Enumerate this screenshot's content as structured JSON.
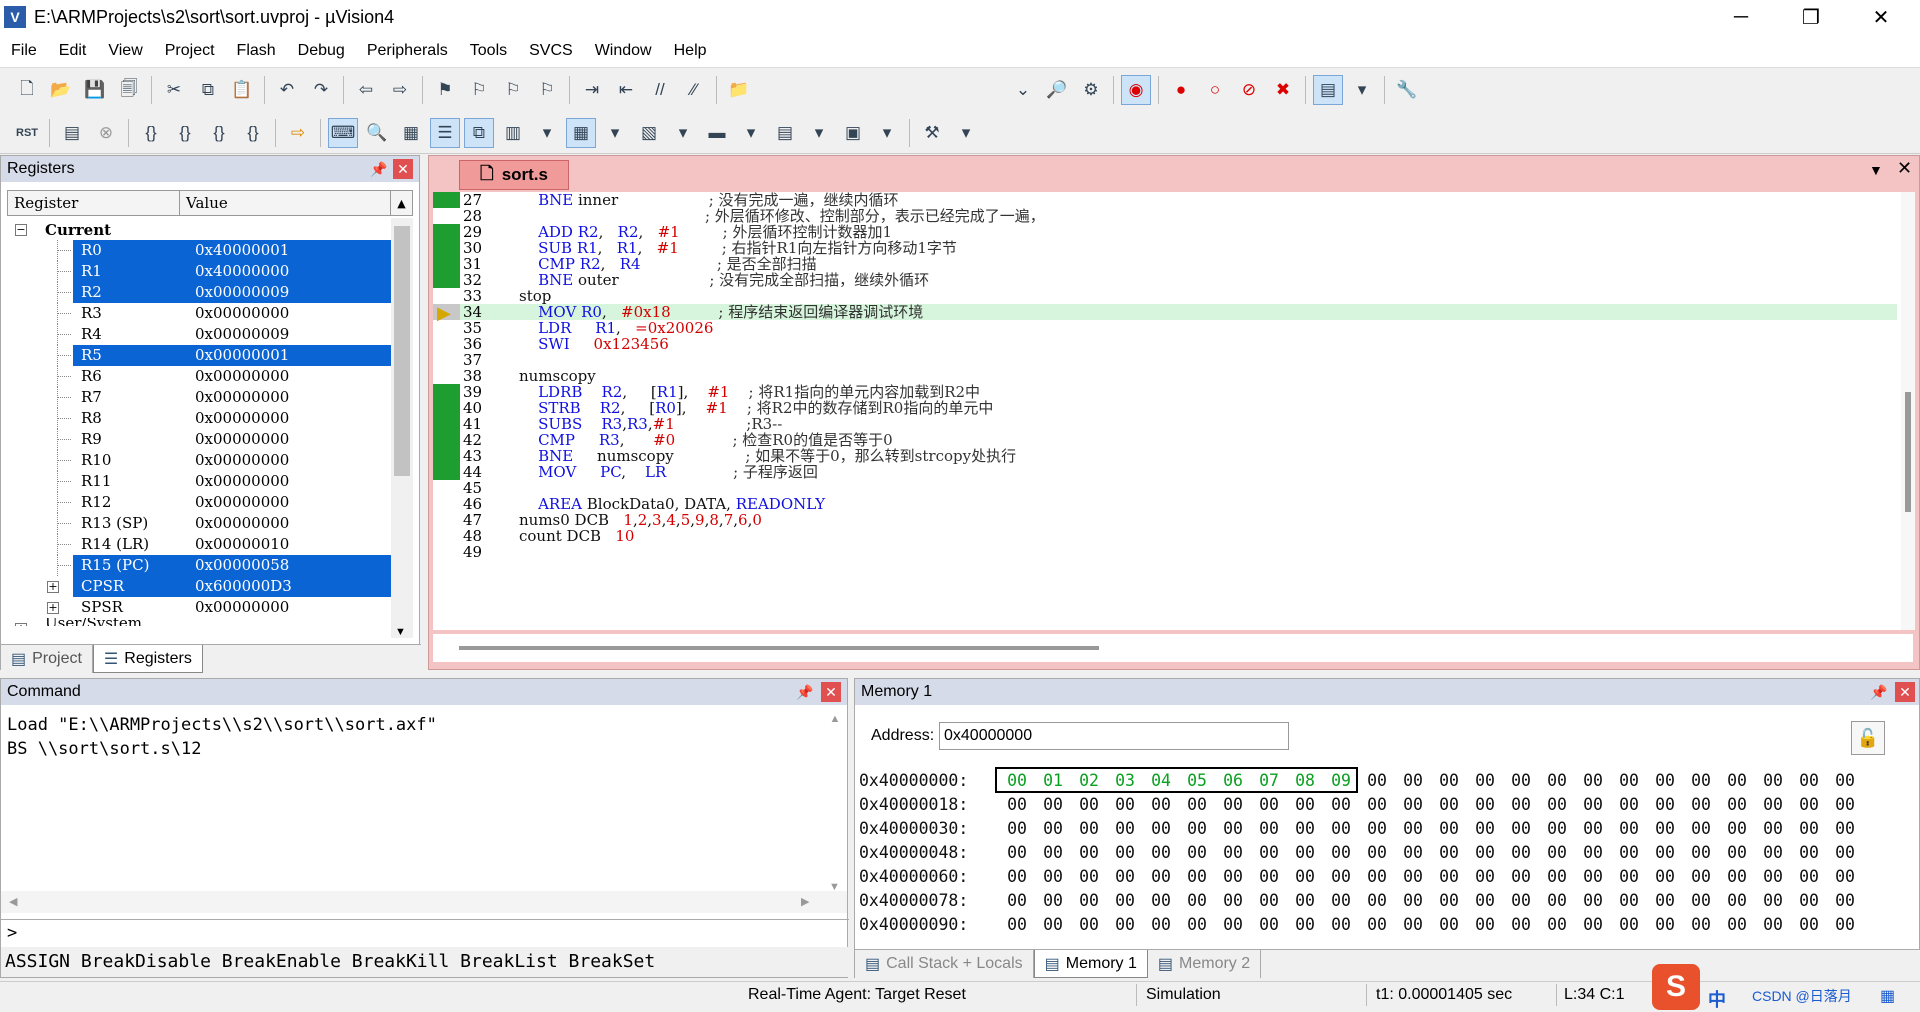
{
  "window": {
    "title": "E:\\ARMProjects\\s2\\sort\\sort.uvproj - µVision4",
    "icon": "v-logo-icon",
    "minimize": "─",
    "maximize": "❐",
    "close": "✕"
  },
  "menu": [
    "File",
    "Edit",
    "View",
    "Project",
    "Flash",
    "Debug",
    "Peripherals",
    "Tools",
    "SVCS",
    "Window",
    "Help"
  ],
  "registers": {
    "title": "Registers",
    "col_register": "Register",
    "col_value": "Value",
    "group": "Current",
    "rows": [
      {
        "name": "R0",
        "value": "0x40000001",
        "selected": true
      },
      {
        "name": "R1",
        "value": "0x40000000",
        "selected": true
      },
      {
        "name": "R2",
        "value": "0x00000009",
        "selected": true
      },
      {
        "name": "R3",
        "value": "0x00000000",
        "selected": false
      },
      {
        "name": "R4",
        "value": "0x00000009",
        "selected": false
      },
      {
        "name": "R5",
        "value": "0x00000001",
        "selected": true
      },
      {
        "name": "R6",
        "value": "0x00000000",
        "selected": false
      },
      {
        "name": "R7",
        "value": "0x00000000",
        "selected": false
      },
      {
        "name": "R8",
        "value": "0x00000000",
        "selected": false
      },
      {
        "name": "R9",
        "value": "0x00000000",
        "selected": false
      },
      {
        "name": "R10",
        "value": "0x00000000",
        "selected": false
      },
      {
        "name": "R11",
        "value": "0x00000000",
        "selected": false
      },
      {
        "name": "R12",
        "value": "0x00000000",
        "selected": false
      },
      {
        "name": "R13 (SP)",
        "value": "0x00000000",
        "selected": false
      },
      {
        "name": "R14 (LR)",
        "value": "0x00000010",
        "selected": false
      },
      {
        "name": "R15 (PC)",
        "value": "0x00000058",
        "selected": true
      },
      {
        "name": "CPSR",
        "value": "0x600000D3",
        "selected": true
      },
      {
        "name": "SPSR",
        "value": "0x00000000",
        "selected": false
      }
    ],
    "partial_row": "User/System",
    "tab_project": "Project",
    "tab_registers": "Registers"
  },
  "editor": {
    "tab": "sort.s",
    "current_line": 34,
    "lines": [
      {
        "n": 27,
        "exec": true,
        "html": "    <span class='kw'>BNE</span> inner                   <span class='cm'>; 没有完成一遍，继续内循环</span>"
      },
      {
        "n": 28,
        "exec": false,
        "html": "                                       <span class='cm'>; 外层循环修改、控制部分，表示已经完成了一遍，</span>"
      },
      {
        "n": 29,
        "exec": true,
        "html": "    <span class='kw'>ADD</span> <span class='kw'>R2</span>,   <span class='kw'>R2</span>,   <span class='num'>#1</span>         <span class='cm'>; 外层循环控制计数器加1</span>"
      },
      {
        "n": 30,
        "exec": true,
        "html": "    <span class='kw'>SUB</span> <span class='kw'>R1</span>,   <span class='kw'>R1</span>,   <span class='num'>#1</span>         <span class='cm'>; 右指针R1向左指针方向移动1字节</span>"
      },
      {
        "n": 31,
        "exec": true,
        "html": "    <span class='kw'>CMP</span> <span class='kw'>R2</span>,   <span class='kw'>R4</span>                <span class='cm'>; 是否全部扫描</span>"
      },
      {
        "n": 32,
        "exec": true,
        "html": "    <span class='kw'>BNE</span> outer                   <span class='cm'>; 没有完成全部扫描，继续外循环</span>"
      },
      {
        "n": 33,
        "exec": false,
        "html": "stop"
      },
      {
        "n": 34,
        "exec": true,
        "html": "    <span class='kw'>MOV</span> <span class='kw'>R0</span>,   <span class='num'>#0x18</span>          <span class='cm'>; 程序结束返回编译器调试环境</span>"
      },
      {
        "n": 35,
        "exec": false,
        "html": "    <span class='kw'>LDR</span>     <span class='kw'>R1</span>,   <span class='num'>=0x20026</span>"
      },
      {
        "n": 36,
        "exec": false,
        "html": "    <span class='kw'>SWI</span>     <span class='num'>0x123456</span>"
      },
      {
        "n": 37,
        "exec": false,
        "html": ""
      },
      {
        "n": 38,
        "exec": false,
        "html": "numscopy"
      },
      {
        "n": 39,
        "exec": true,
        "html": "    <span class='kw'>LDRB</span>    <span class='kw'>R2</span>,     [<span class='kw'>R1</span>],    <span class='num'>#1</span>    <span class='cm'>; 将R1指向的单元内容加载到R2中</span>"
      },
      {
        "n": 40,
        "exec": true,
        "html": "    <span class='kw'>STRB</span>    <span class='kw'>R2</span>,     [<span class='kw'>R0</span>],    <span class='num'>#1</span>    <span class='cm'>; 将R2中的数存储到R0指向的单元中</span>"
      },
      {
        "n": 41,
        "exec": true,
        "html": "    <span class='kw'>SUBS</span>    <span class='kw'>R3</span>,<span class='kw'>R3</span>,<span class='num'>#1</span>               <span class='cm'>;R3--</span>"
      },
      {
        "n": 42,
        "exec": true,
        "html": "    <span class='kw'>CMP</span>     <span class='kw'>R3</span>,      <span class='num'>#0</span>            <span class='cm'>; 检查R0的值是否等于0</span>"
      },
      {
        "n": 43,
        "exec": true,
        "html": "    <span class='kw'>BNE</span>     numscopy               <span class='cm'>; 如果不等于0，那么转到strcopy处执行</span>"
      },
      {
        "n": 44,
        "exec": true,
        "html": "    <span class='kw'>MOV</span>     <span class='kw'>PC</span>,    <span class='kw'>LR</span>              <span class='cm'>; 子程序返回</span>"
      },
      {
        "n": 45,
        "exec": false,
        "html": ""
      },
      {
        "n": 46,
        "exec": false,
        "html": "    <span class='kw'>AREA</span> BlockData0, DATA, <span class='kw'>READONLY</span>"
      },
      {
        "n": 47,
        "exec": false,
        "html": "nums0 DCB   <span class='num'>1</span>,<span class='num'>2</span>,<span class='num'>3</span>,<span class='num'>4</span>,<span class='num'>5</span>,<span class='num'>9</span>,<span class='num'>8</span>,<span class='num'>7</span>,<span class='num'>6</span>,<span class='num'>0</span>"
      },
      {
        "n": 48,
        "exec": false,
        "html": "count DCB   <span class='num'>10</span>"
      },
      {
        "n": 49,
        "exec": false,
        "html": ""
      }
    ]
  },
  "command": {
    "title": "Command",
    "output": "Load \"E:\\\\ARMProjects\\\\s2\\\\sort\\\\sort.axf\"\nBS \\\\sort\\sort.s\\12",
    "prompt": ">",
    "hint": "ASSIGN BreakDisable BreakEnable BreakKill BreakList BreakSet"
  },
  "memory": {
    "title": "Memory 1",
    "address_label": "Address:",
    "address": "0x40000000",
    "rows": [
      {
        "addr": "0x40000000:",
        "bytes": [
          "00",
          "01",
          "02",
          "03",
          "04",
          "05",
          "06",
          "07",
          "08",
          "09",
          "00",
          "00",
          "00",
          "00",
          "00",
          "00",
          "00",
          "00",
          "00",
          "00",
          "00",
          "00",
          "00",
          "00"
        ]
      },
      {
        "addr": "0x40000018:",
        "bytes": [
          "00",
          "00",
          "00",
          "00",
          "00",
          "00",
          "00",
          "00",
          "00",
          "00",
          "00",
          "00",
          "00",
          "00",
          "00",
          "00",
          "00",
          "00",
          "00",
          "00",
          "00",
          "00",
          "00",
          "00"
        ]
      },
      {
        "addr": "0x40000030:",
        "bytes": [
          "00",
          "00",
          "00",
          "00",
          "00",
          "00",
          "00",
          "00",
          "00",
          "00",
          "00",
          "00",
          "00",
          "00",
          "00",
          "00",
          "00",
          "00",
          "00",
          "00",
          "00",
          "00",
          "00",
          "00"
        ]
      },
      {
        "addr": "0x40000048:",
        "bytes": [
          "00",
          "00",
          "00",
          "00",
          "00",
          "00",
          "00",
          "00",
          "00",
          "00",
          "00",
          "00",
          "00",
          "00",
          "00",
          "00",
          "00",
          "00",
          "00",
          "00",
          "00",
          "00",
          "00",
          "00"
        ]
      },
      {
        "addr": "0x40000060:",
        "bytes": [
          "00",
          "00",
          "00",
          "00",
          "00",
          "00",
          "00",
          "00",
          "00",
          "00",
          "00",
          "00",
          "00",
          "00",
          "00",
          "00",
          "00",
          "00",
          "00",
          "00",
          "00",
          "00",
          "00",
          "00"
        ]
      },
      {
        "addr": "0x40000078:",
        "bytes": [
          "00",
          "00",
          "00",
          "00",
          "00",
          "00",
          "00",
          "00",
          "00",
          "00",
          "00",
          "00",
          "00",
          "00",
          "00",
          "00",
          "00",
          "00",
          "00",
          "00",
          "00",
          "00",
          "00",
          "00"
        ]
      },
      {
        "addr": "0x40000090:",
        "bytes": [
          "00",
          "00",
          "00",
          "00",
          "00",
          "00",
          "00",
          "00",
          "00",
          "00",
          "00",
          "00",
          "00",
          "00",
          "00",
          "00",
          "00",
          "00",
          "00",
          "00",
          "00",
          "00",
          "00",
          "00"
        ]
      }
    ],
    "tabs": [
      "Call Stack + Locals",
      "Memory 1",
      "Memory 2"
    ]
  },
  "status": {
    "agent": "Real-Time Agent: Target Reset",
    "mode": "Simulation",
    "time": "t1: 0.00001405 sec",
    "pos": "L:34 C:1",
    "watermark": "CSDN @日落月",
    "ime_label": "中"
  }
}
